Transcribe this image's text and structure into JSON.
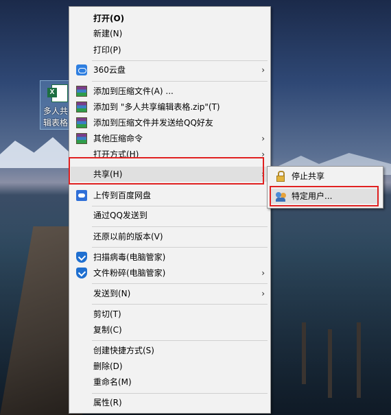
{
  "desktop": {
    "file_label_line1": "多人共",
    "file_label_line2": "辑表格"
  },
  "context_menu": {
    "open": "打开(O)",
    "new": "新建(N)",
    "print": "打印(P)",
    "cloud360": "360云盘",
    "add_to_archive": "添加到压缩文件(A) ...",
    "add_to_zip": "添加到 \"多人共享编辑表格.zip\"(T)",
    "add_and_send_qq": "添加到压缩文件并发送给QQ好友",
    "other_compress": "其他压缩命令",
    "open_with": "打开方式(H)",
    "share": "共享(H)",
    "upload_baidu": "上传到百度网盘",
    "send_via_qq": "通过QQ发送到",
    "restore_previous": "还原以前的版本(V)",
    "scan_virus": "扫描病毒(电脑管家)",
    "shred_file": "文件粉碎(电脑管家)",
    "send_to": "发送到(N)",
    "cut": "剪切(T)",
    "copy": "复制(C)",
    "create_shortcut": "创建快捷方式(S)",
    "delete": "删除(D)",
    "rename": "重命名(M)",
    "properties": "属性(R)"
  },
  "share_submenu": {
    "stop_sharing": "停止共享",
    "specific_people": "特定用户..."
  },
  "icons": {
    "submenu_arrow": "›"
  },
  "colors": {
    "highlight_box": "#e02020",
    "menu_bg": "#f2f2f2"
  }
}
